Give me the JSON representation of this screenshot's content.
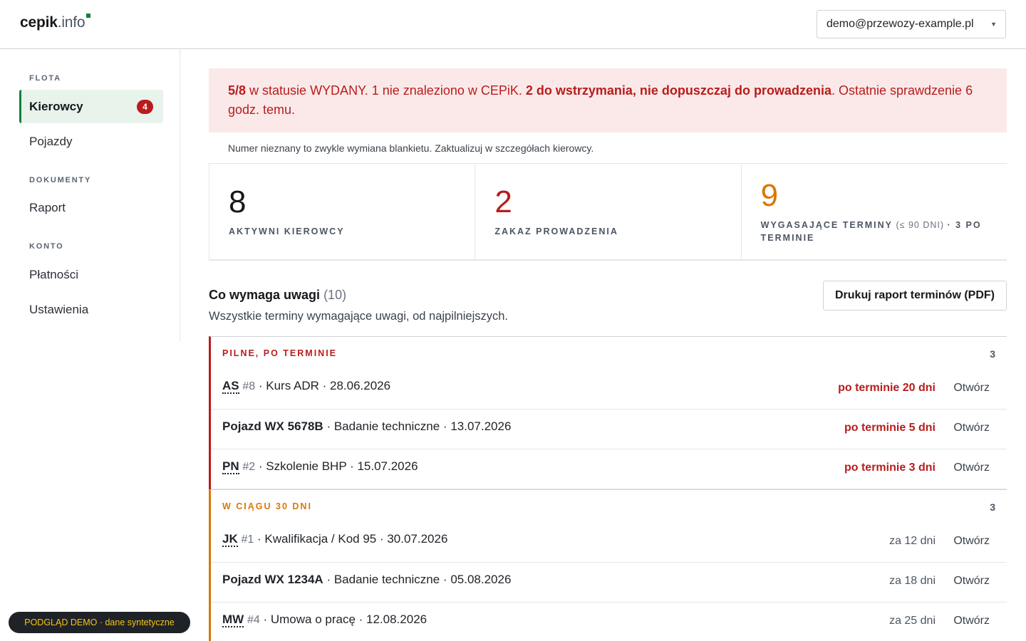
{
  "header": {
    "logo_part1": "cepik",
    "logo_part2": ".info",
    "account_email": "demo@przewozy-example.pl"
  },
  "sidebar": {
    "sections": [
      {
        "title": "FLOTA"
      },
      {
        "title": "DOKUMENTY"
      },
      {
        "title": "KONTO"
      }
    ],
    "items": [
      {
        "label": "Kierowcy",
        "badge": "4",
        "active": true
      },
      {
        "label": "Pojazdy"
      },
      {
        "label": "Raport"
      },
      {
        "label": "Płatności"
      },
      {
        "label": "Ustawienia"
      }
    ]
  },
  "alert": {
    "part1_bold": "5/8",
    "part2": " w statusie WYDANY. 1 nie znaleziono w CEPiK. ",
    "part3_bold": "2 do wstrzymania, nie dopuszczaj do prowadzenia",
    "part4": ". Ostatnie sprawdzenie 6 godz. temu."
  },
  "hint": "Numer nieznany to zwykle wymiana blankietu. Zaktualizuj w szczegółach kierowcy.",
  "stats": [
    {
      "value": "8",
      "label": "AKTYWNI KIEROWCY",
      "color": "#16181b"
    },
    {
      "value": "2",
      "label": "ZAKAZ PROWADZENIA",
      "color": "#b91c1c"
    },
    {
      "value": "9",
      "label_a": "WYGASAJĄCE TERMINY",
      "label_b": " (≤ 90 DNI) ",
      "label_c": "· 3 PO TERMINIE",
      "color": "#d97706"
    }
  ],
  "attention": {
    "title": "Co wymaga uwagi",
    "count": "(10)",
    "subtitle": "Wszystkie terminy wymagające uwagi, od najpilniejszych.",
    "pdf_button": "Drukuj raport terminów (PDF)"
  },
  "groups": [
    {
      "title": "PILNE, PO TERMINIE",
      "count": "3",
      "rows": [
        {
          "abbr": "AS",
          "num": "#8",
          "rest": " · Kurs ADR · 28.06.2026",
          "due": "po terminie 20 dni",
          "open": "Otwórz"
        },
        {
          "strong": "Pojazd WX 5678B",
          "rest": " · Badanie techniczne · 13.07.2026",
          "due": "po terminie 5 dni",
          "open": "Otwórz"
        },
        {
          "abbr": "PN",
          "num": "#2",
          "rest": " · Szkolenie BHP · 15.07.2026",
          "due": "po terminie 3 dni",
          "open": "Otwórz"
        }
      ]
    },
    {
      "title": "W CIĄGU 30 DNI",
      "count": "3",
      "rows": [
        {
          "abbr": "JK",
          "num": "#1",
          "rest": " · Kwalifikacja / Kod 95 · 30.07.2026",
          "due": "za 12 dni",
          "open": "Otwórz"
        },
        {
          "strong": "Pojazd WX 1234A",
          "rest": " · Badanie techniczne · 05.08.2026",
          "due": "za 18 dni",
          "open": "Otwórz"
        },
        {
          "abbr": "MW",
          "num": "#4",
          "rest": " · Umowa o pracę · 12.08.2026",
          "due": "za 25 dni",
          "open": "Otwórz"
        }
      ]
    }
  ],
  "demo_badge": "PODGLĄD DEMO · dane syntetyczne"
}
